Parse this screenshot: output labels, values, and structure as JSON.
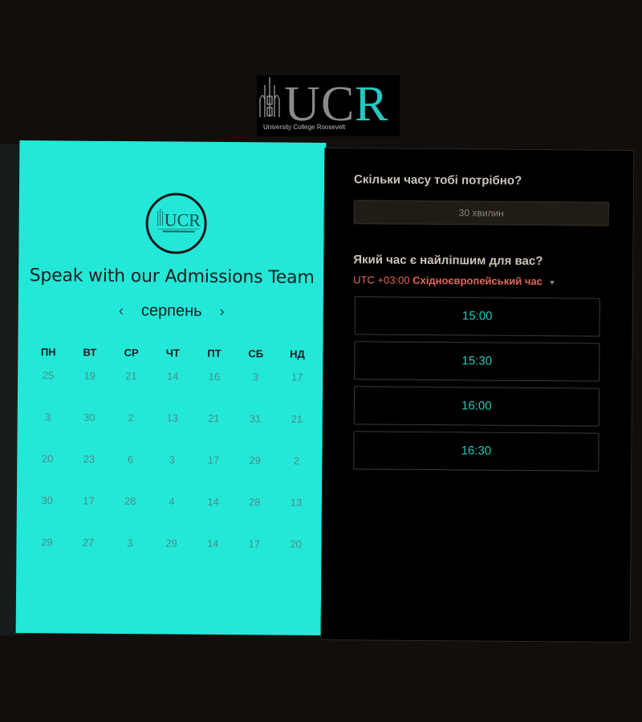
{
  "header": {
    "logo_icon": "ucr-logo",
    "logo_text": "UCR",
    "logo_subtitle": "University College Roosevelt"
  },
  "left_panel": {
    "logo_icon": "ucr-round-logo",
    "title": "Speak with our Admissions Team",
    "month": "серпень",
    "prev_icon": "chevron-left-icon",
    "next_icon": "chevron-right-icon",
    "weekdays": [
      "ПН",
      "ВТ",
      "СР",
      "ЧТ",
      "ПТ",
      "СБ",
      "НД"
    ],
    "days": [
      "25",
      "19",
      "21",
      "14",
      "16",
      "3",
      "17",
      "3",
      "30",
      "2",
      "13",
      "21",
      "31",
      "21",
      "20",
      "23",
      "6",
      "3",
      "17",
      "29",
      "2",
      "30",
      "17",
      "28",
      "4",
      "14",
      "28",
      "13",
      "29",
      "27",
      "3",
      "29",
      "14",
      "17",
      "20"
    ],
    "accent_color": "#23e8d8"
  },
  "right_panel": {
    "duration_question": "Скільки часу тобі потрібно?",
    "duration_value": "30 хвилин",
    "time_question": "Який час є найліпшим для вас?",
    "timezone_offset": "UTC +03:00",
    "timezone_name": "Східноєвропейський час",
    "timezone_icon": "caret-down-icon",
    "slots": [
      "15:00",
      "15:30",
      "16:00",
      "16:30"
    ],
    "slot_color": "#23c9bb",
    "timezone_color": "#e2685a"
  }
}
